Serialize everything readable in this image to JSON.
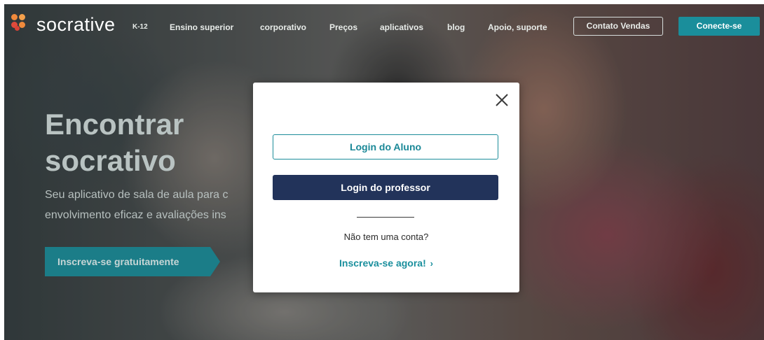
{
  "nav": {
    "brand": "socrative",
    "links": [
      "K-12",
      "Ensino superior",
      "corporativo",
      "Preços",
      "aplicativos",
      "blog",
      "Apoio, suporte"
    ],
    "contact_sales": "Contato Vendas",
    "connect": "Conecte-se"
  },
  "hero": {
    "title_line1": "Encontrar",
    "title_line2": "socrativo",
    "subtitle_line1": "Seu aplicativo de sala de aula para c",
    "subtitle_line2": "envolvimento eficaz e avaliações ins",
    "signup_button": "Inscreva-se gratuitamente"
  },
  "modal": {
    "student_login": "Login do Aluno",
    "teacher_login": "Login do professor",
    "no_account": "Não tem uma conta?",
    "signup_now": "Inscreva-se agora!",
    "signup_arrow": "›"
  },
  "colors": {
    "accent": "#1a8e9b",
    "navy": "#22335a",
    "logo_orange": "#f08a3c",
    "logo_red": "#e04a3b"
  },
  "icons": [
    "socrative-logo-icon",
    "close-icon",
    "chevron-right-icon"
  ]
}
